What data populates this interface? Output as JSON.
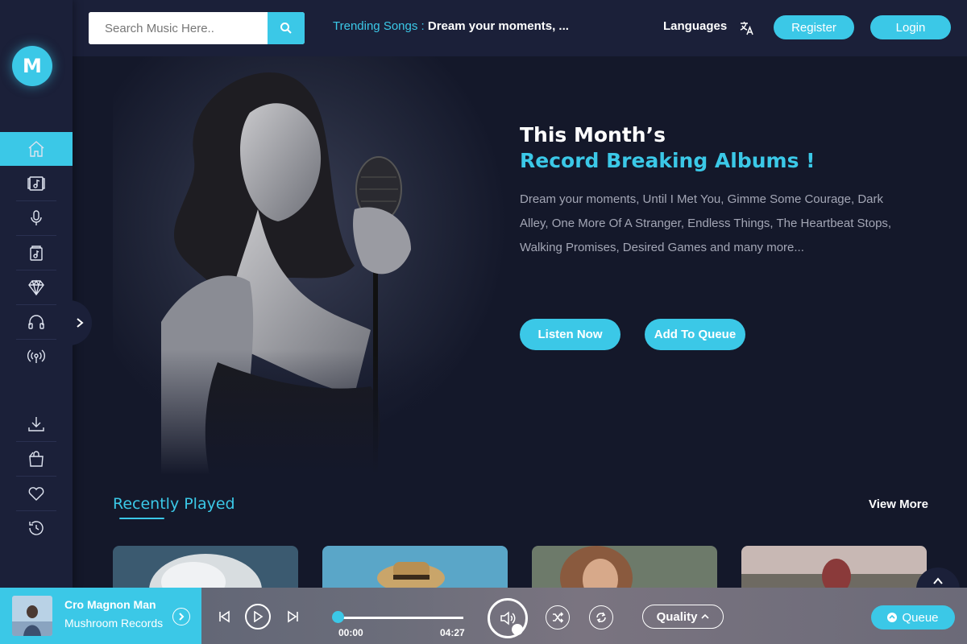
{
  "header": {
    "search_placeholder": "Search Music Here..",
    "trending_label": "Trending Songs",
    "trending_separator": ":",
    "trending_value": "Dream your moments, ...",
    "languages_label": "Languages",
    "register_label": "Register",
    "login_label": "Login"
  },
  "logo": {
    "letter": "M"
  },
  "sidebar": {
    "items": [
      {
        "icon": "home-icon",
        "active": true
      },
      {
        "icon": "music-album-icon"
      },
      {
        "icon": "microphone-icon"
      },
      {
        "icon": "music-file-icon"
      },
      {
        "icon": "diamond-icon"
      },
      {
        "icon": "headphones-icon"
      },
      {
        "icon": "radio-broadcast-icon"
      },
      {
        "icon": "download-icon"
      },
      {
        "icon": "shopping-bag-icon"
      },
      {
        "icon": "heart-icon"
      },
      {
        "icon": "history-icon"
      }
    ]
  },
  "hero": {
    "title_line1": "This Month’s",
    "title_line2": "Record Breaking Albums !",
    "description": "Dream your moments, Until I Met You, Gimme Some Courage, Dark Alley, One More Of A Stranger, Endless Things, The Heartbeat Stops, Walking Promises, Desired Games and many more...",
    "listen_now_label": "Listen Now",
    "add_to_queue_label": "Add To Queue"
  },
  "recently_played": {
    "title": "Recently Played",
    "view_more_label": "View More"
  },
  "player": {
    "track_title": "Cro Magnon Man",
    "track_artist": "Mushroom Records",
    "time_current": "00:00",
    "time_total": "04:27",
    "progress_fraction": 0.0,
    "quality_label": "Quality",
    "queue_label": "Queue"
  },
  "colors": {
    "accent": "#3bc8e7",
    "background": "#14182a",
    "sidebar": "#1b2039"
  }
}
